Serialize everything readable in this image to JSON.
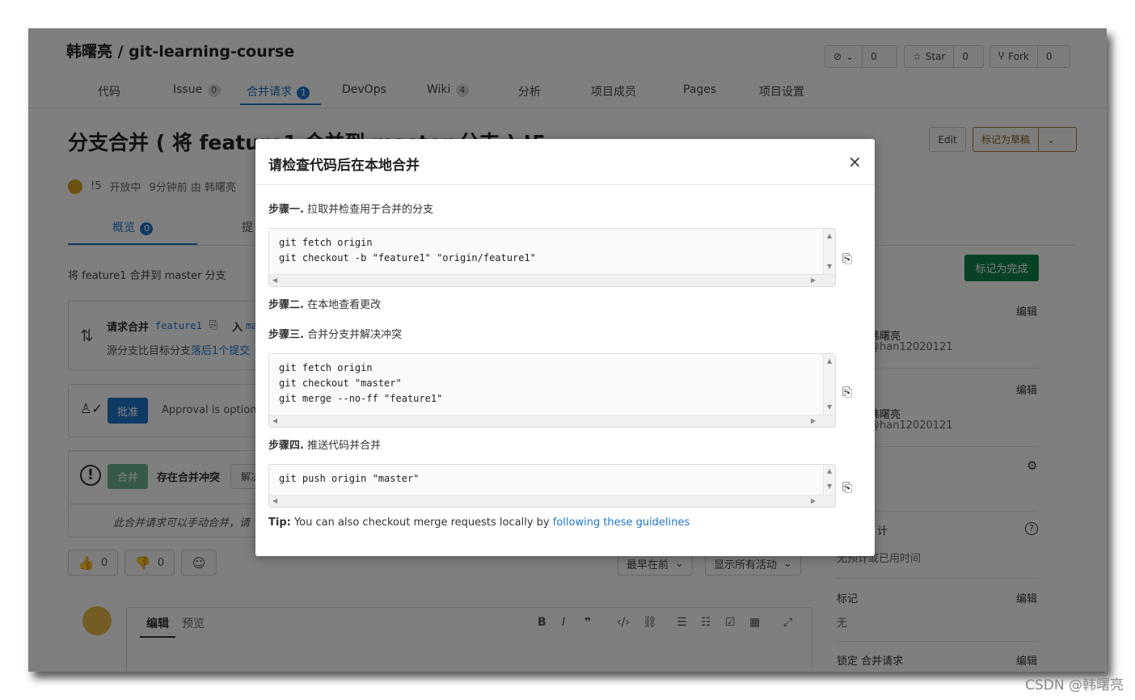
{
  "project": {
    "title": "韩曙亮 / git-learning-course"
  },
  "nav_tabs": [
    {
      "label": "代码"
    },
    {
      "label": "Issue",
      "badge": "0"
    },
    {
      "label": "合并请求",
      "badge": "1"
    },
    {
      "label": "DevOps"
    },
    {
      "label": "Wiki",
      "badge": "4"
    },
    {
      "label": "分析"
    },
    {
      "label": "项目成员"
    },
    {
      "label": "Pages"
    },
    {
      "label": "项目设置"
    }
  ],
  "header_buttons": {
    "watch_count": "0",
    "star_label": "Star",
    "star_count": "0",
    "fork_label": "Fork",
    "fork_count": "0"
  },
  "mr": {
    "title": "分支合并 ( 将 feature1 合并到 master 分支 ) !5",
    "edit_label": "Edit",
    "draft_label": "标记为草稿",
    "meta": {
      "id": "!5",
      "status": "开放中",
      "time": "9分钟前 由 韩曙亮"
    },
    "subtabs": [
      {
        "label": "概览",
        "badge": "0"
      },
      {
        "label": "提"
      }
    ],
    "description": "将 feature1 合并到 master 分支",
    "request_card": {
      "label": "请求合并",
      "source": "feature1",
      "into": "入",
      "target": "ma",
      "behind_text": "源分支比目标分支",
      "behind_link": "落后1个提交"
    },
    "approve": {
      "button": "批准",
      "text": "Approval is option"
    },
    "merge": {
      "button": "合并",
      "conflict": "存在合并冲突",
      "resolve": "解决",
      "note": "此合并请求可以手动合并，请"
    },
    "reactions": {
      "thumbs_up": "0",
      "thumbs_down": "0"
    },
    "sort_label": "最早在前",
    "filter_label": "显示所有活动",
    "editor": {
      "write": "编辑",
      "preview": "预览"
    }
  },
  "sidebar": {
    "mark_done": "标记为完成",
    "edit": "编辑",
    "assignee_name": "韩曙亮",
    "assignee_handle": "@han12020121",
    "reviewer_name": "韩曙亮",
    "reviewer_handle": "@han12020121",
    "time_tracking_suffix": "计",
    "time_tracking_text": "无预计或已用时间",
    "labels_title": "标记",
    "labels_value": "无",
    "lock_title": "锁定 合并请求"
  },
  "modal": {
    "title": "请检查代码后在本地合并",
    "close": "×",
    "step1": {
      "label": "步骤一.",
      "text": "拉取并检查用于合并的分支",
      "code": "git fetch origin\ngit checkout -b \"feature1\" \"origin/feature1\""
    },
    "step2": {
      "label": "步骤二.",
      "text": "在本地查看更改"
    },
    "step3": {
      "label": "步骤三.",
      "text": "合并分支并解决冲突",
      "code": "git fetch origin\ngit checkout \"master\"\ngit merge --no-ff \"feature1\""
    },
    "step4": {
      "label": "步骤四.",
      "text": "推送代码并合并",
      "code": "git push origin \"master\""
    },
    "tip": {
      "label": "Tip:",
      "text": "You can also checkout merge requests locally by",
      "link": "following these guidelines"
    }
  },
  "watermark": "CSDN @韩曙亮",
  "colors": {
    "link": "#1f75cb",
    "approve": "#1f75cb",
    "done": "#108548",
    "merge": "#108548",
    "draft": "#a97b3c"
  }
}
